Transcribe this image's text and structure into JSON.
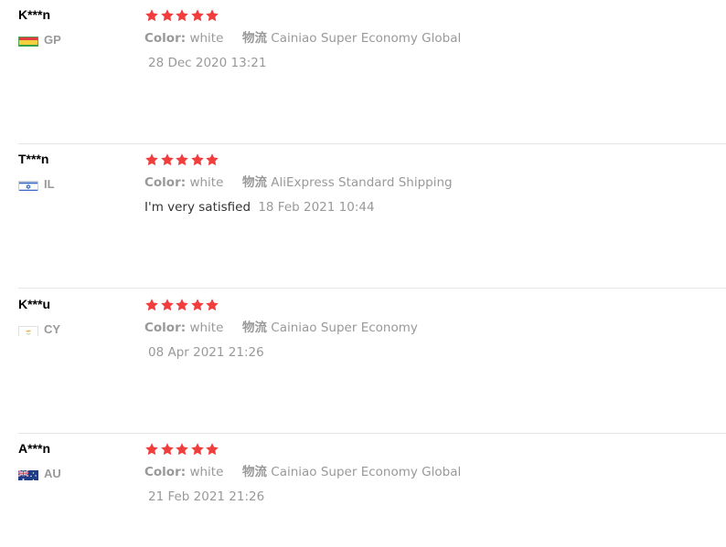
{
  "colors": {
    "star": "#f23d3d",
    "muted_text": "#999999",
    "body_text": "#333333",
    "divider": "#e6e6e6"
  },
  "reviews": [
    {
      "buyer": "K***n",
      "country": "GP",
      "flag": "flag-gp-icon",
      "rating": 5,
      "color_label": "Color:",
      "color_value": "white",
      "shipping_label": "物流",
      "shipping_value": "Cainiao Super Economy Global",
      "comment": "",
      "date": "28 Dec 2020 13:21"
    },
    {
      "buyer": "T***n",
      "country": "IL",
      "flag": "flag-il-icon",
      "rating": 5,
      "color_label": "Color:",
      "color_value": "white",
      "shipping_label": "物流",
      "shipping_value": "AliExpress Standard Shipping",
      "comment": "I'm very satisfied",
      "date": "18 Feb 2021 10:44"
    },
    {
      "buyer": "K***u",
      "country": "CY",
      "flag": "flag-cy-icon",
      "rating": 5,
      "color_label": "Color:",
      "color_value": "white",
      "shipping_label": "物流",
      "shipping_value": "Cainiao Super Economy",
      "comment": "",
      "date": "08 Apr 2021 21:26"
    },
    {
      "buyer": "A***n",
      "country": "AU",
      "flag": "flag-au-icon",
      "rating": 5,
      "color_label": "Color:",
      "color_value": "white",
      "shipping_label": "物流",
      "shipping_value": "Cainiao Super Economy Global",
      "comment": "",
      "date": "21 Feb 2021 21:26"
    }
  ]
}
